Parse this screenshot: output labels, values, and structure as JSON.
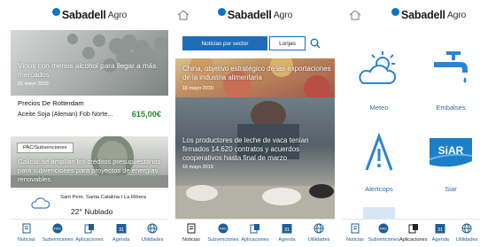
{
  "colors": {
    "brand_blue": "#0b74c9",
    "nav_blue": "#1d5e97",
    "tile_blue": "#2a84d8",
    "price_green": "#2f8a2f"
  },
  "brand": {
    "name": "Sabadell",
    "suffix": "Agro"
  },
  "nav": [
    {
      "label": "Noticias",
      "icon": "document-icon"
    },
    {
      "label": "Subvenciones",
      "icon": "pac-icon"
    },
    {
      "label": "Aplicaciones",
      "icon": "apps-icon"
    },
    {
      "label": "Agenda",
      "icon": "calendar-icon",
      "badge": "31"
    },
    {
      "label": "Utilidades",
      "icon": "globe-icon"
    }
  ],
  "screen1": {
    "hero": {
      "title": "Vinos con menos alcohol para llegar a más mercados",
      "date": "21 mayo 2019"
    },
    "prices": {
      "title": "Precios De Rotterdam",
      "item": "Aceite Soja (Aleman) Fob Norte...",
      "value": "615,00€"
    },
    "news": {
      "tag": "PAC/Subvenciones",
      "title": "Galicia: se amplían los créditos presupuestarios para subvenciones para proyectos de energías renovables"
    },
    "weather": {
      "location": "Sant Pere, Santa Catalina I La Ribera",
      "condition": "22° Nublado"
    }
  },
  "screen2": {
    "tabs": [
      "Noticias por sector",
      "Lonjas"
    ],
    "news": [
      {
        "title": "China, objetivo estratégico de las exportaciones de la industria alimentaria",
        "date": "16 mayo 2019"
      },
      {
        "title": "Los productores de leche de vaca tenían firmados 14.620 contratos y acuerdos cooperativos hasta final de marzo",
        "date": "16 mayo 2019"
      }
    ]
  },
  "screen3": {
    "tiles": [
      {
        "label": "Meteo",
        "icon": "weather-icon"
      },
      {
        "label": "Embalses",
        "icon": "faucet-icon"
      },
      {
        "label": "Alertcops",
        "icon": "alertcops-icon"
      },
      {
        "label": "Siar",
        "icon": "siar-icon",
        "logo": "SiAR"
      }
    ]
  }
}
